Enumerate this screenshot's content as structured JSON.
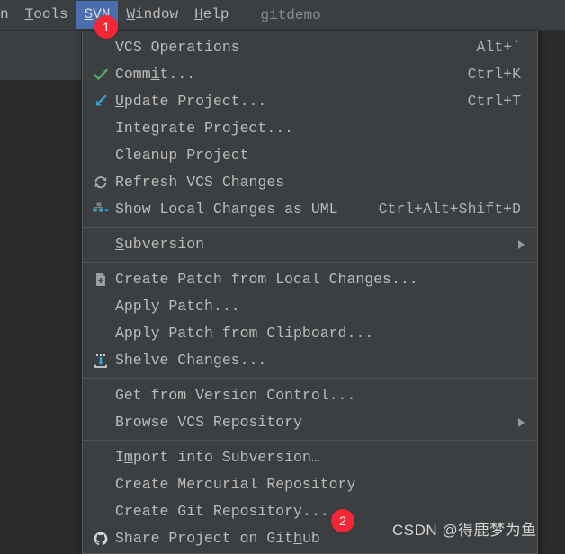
{
  "menubar": {
    "items": [
      {
        "label": "n",
        "mnemonic": "",
        "clipped": true,
        "active": false
      },
      {
        "label": "Tools",
        "mnemonic": "T",
        "clipped": false,
        "active": false
      },
      {
        "label": "SVN",
        "mnemonic": "S",
        "clipped": false,
        "active": true
      },
      {
        "label": "Window",
        "mnemonic": "W",
        "clipped": false,
        "active": false
      },
      {
        "label": "Help",
        "mnemonic": "H",
        "clipped": false,
        "active": false
      }
    ],
    "project_name": "gitdemo"
  },
  "vcs_menu": {
    "groups": [
      {
        "items": [
          {
            "label": "VCS Operations",
            "mnemonic": "",
            "shortcut": "Alt+`",
            "icon": "",
            "submenu": false
          },
          {
            "label": "Commit...",
            "mnemonic": "i",
            "shortcut": "Ctrl+K",
            "icon": "check-icon",
            "submenu": false
          },
          {
            "label": "Update Project...",
            "mnemonic": "U",
            "shortcut": "Ctrl+T",
            "icon": "update-arrow-icon",
            "submenu": false
          },
          {
            "label": "Integrate Project...",
            "mnemonic": "g",
            "shortcut": "",
            "icon": "",
            "submenu": false
          },
          {
            "label": "Cleanup Project",
            "mnemonic": "",
            "shortcut": "",
            "icon": "",
            "submenu": false
          },
          {
            "label": "Refresh VCS Changes",
            "mnemonic": "",
            "shortcut": "",
            "icon": "refresh-icon",
            "submenu": false
          },
          {
            "label": "Show Local Changes as UML",
            "mnemonic": "",
            "shortcut": "Ctrl+Alt+Shift+D",
            "icon": "uml-diagram-icon",
            "submenu": false
          }
        ]
      },
      {
        "items": [
          {
            "label": "Subversion",
            "mnemonic": "S",
            "shortcut": "",
            "icon": "",
            "submenu": true
          }
        ]
      },
      {
        "items": [
          {
            "label": "Create Patch from Local Changes...",
            "mnemonic": "",
            "shortcut": "",
            "icon": "create-patch-icon",
            "submenu": false
          },
          {
            "label": "Apply Patch...",
            "mnemonic": "",
            "shortcut": "",
            "icon": "",
            "submenu": false
          },
          {
            "label": "Apply Patch from Clipboard...",
            "mnemonic": "",
            "shortcut": "",
            "icon": "",
            "submenu": false
          },
          {
            "label": "Shelve Changes...",
            "mnemonic": "",
            "shortcut": "",
            "icon": "shelve-icon",
            "submenu": false
          }
        ]
      },
      {
        "items": [
          {
            "label": "Get from Version Control...",
            "mnemonic": "",
            "shortcut": "",
            "icon": "",
            "submenu": false
          },
          {
            "label": "Browse VCS Repository",
            "mnemonic": "",
            "shortcut": "",
            "icon": "",
            "submenu": true
          }
        ]
      },
      {
        "items": [
          {
            "label": "Import into Subversion…",
            "mnemonic": "m",
            "shortcut": "",
            "icon": "",
            "submenu": false
          },
          {
            "label": "Create Mercurial Repository",
            "mnemonic": "",
            "shortcut": "",
            "icon": "",
            "submenu": false
          },
          {
            "label": "Create Git Repository...",
            "mnemonic": "",
            "shortcut": "",
            "icon": "",
            "submenu": false
          },
          {
            "label": "Share Project on GitHub",
            "mnemonic": "h",
            "shortcut": "",
            "icon": "github-icon",
            "submenu": false
          }
        ]
      }
    ]
  },
  "annotations": {
    "badge_1": "1",
    "badge_2": "2"
  },
  "watermark": {
    "text": "CSDN @得鹿梦为鱼"
  },
  "colors": {
    "menu_background": "#3c3f41",
    "editor_background": "#2b2b2b",
    "menu_text": "#bbbbbb",
    "highlight": "#4b6eaf",
    "badge_red": "#f32735",
    "separator": "#515151"
  }
}
